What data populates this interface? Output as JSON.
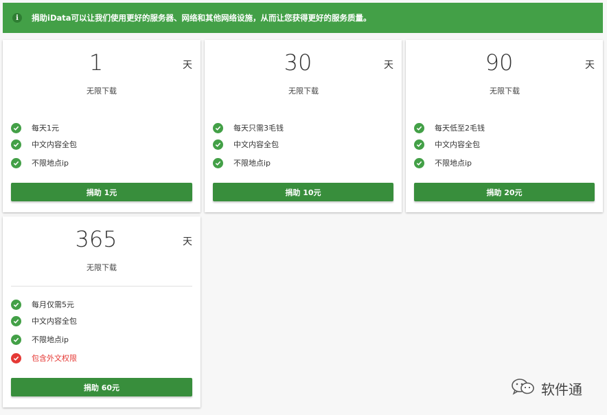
{
  "banner": {
    "icon": "info-icon",
    "text": "捐助iData可以让我们使用更好的服务器、网络和其他网络设施，从而让您获得更好的服务质量。"
  },
  "plans": [
    {
      "days": "1",
      "unit": "天",
      "subtitle": "无限下载",
      "features": [
        {
          "label": "每天1元",
          "included": true
        },
        {
          "label": "中文内容全包",
          "included": true
        },
        {
          "label": "不限地点ip",
          "included": true
        }
      ],
      "button": "捐助 1元"
    },
    {
      "days": "30",
      "unit": "天",
      "subtitle": "无限下载",
      "features": [
        {
          "label": "每天只需3毛钱",
          "included": true
        },
        {
          "label": "中文内容全包",
          "included": true
        },
        {
          "label": "不限地点ip",
          "included": true
        }
      ],
      "button": "捐助 10元"
    },
    {
      "days": "90",
      "unit": "天",
      "subtitle": "无限下载",
      "features": [
        {
          "label": "每天低至2毛钱",
          "included": true
        },
        {
          "label": "中文内容全包",
          "included": true
        },
        {
          "label": "不限地点ip",
          "included": true
        }
      ],
      "button": "捐助 20元"
    },
    {
      "days": "365",
      "unit": "天",
      "subtitle": "无限下载",
      "features": [
        {
          "label": "每月仅需5元",
          "included": true
        },
        {
          "label": "中文内容全包",
          "included": true
        },
        {
          "label": "不限地点ip",
          "included": true
        },
        {
          "label": "包含外文权限",
          "included": false
        }
      ],
      "button": "捐助 60元"
    }
  ],
  "watermark": {
    "icon": "wechat-icon",
    "text": "软件通"
  },
  "colors": {
    "accent": "#43a047",
    "button": "#388e3c",
    "excluded": "#e53935"
  }
}
